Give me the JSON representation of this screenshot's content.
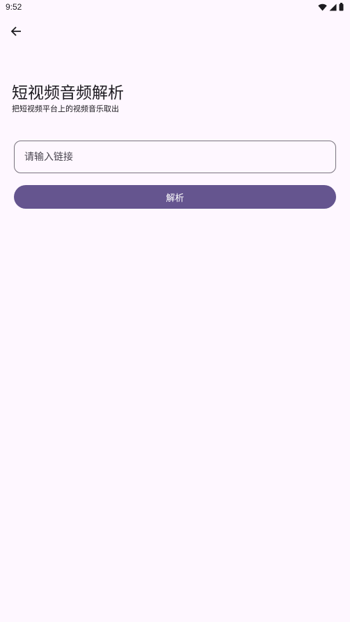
{
  "status_bar": {
    "time": "9:52",
    "icons": [
      "wifi-icon",
      "signal-icon",
      "battery-icon"
    ]
  },
  "app_bar": {
    "back_icon": "arrow-back-icon"
  },
  "header": {
    "title": "短视频音频解析",
    "subtitle": "把短视频平台上的视频音乐取出"
  },
  "form": {
    "link_input": {
      "placeholder": "请输入链接",
      "value": ""
    },
    "parse_button_label": "解析"
  },
  "colors": {
    "background": "#FEF7FF",
    "primary": "#65558F",
    "outline": "#79747E",
    "on_surface": "#1D1B20"
  }
}
